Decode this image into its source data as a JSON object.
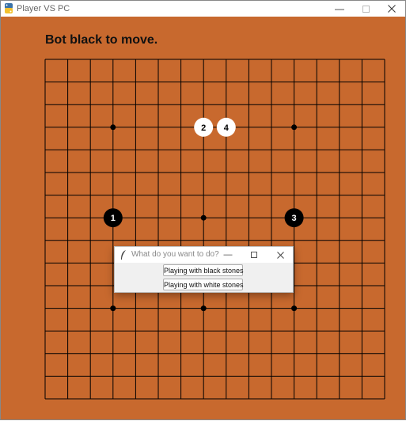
{
  "window": {
    "title": "Player VS PC",
    "icon": "python-icon"
  },
  "status_text": "Bot black to move.",
  "colors": {
    "board": "#c8692e",
    "line": "#000000",
    "black_stone": "#000000",
    "white_stone": "#ffffff"
  },
  "board": {
    "size": 15,
    "star_points": [
      [
        3,
        3
      ],
      [
        3,
        11
      ],
      [
        7,
        3
      ],
      [
        7,
        7
      ],
      [
        7,
        11
      ],
      [
        11,
        3
      ],
      [
        11,
        7
      ],
      [
        11,
        11
      ]
    ],
    "stones": [
      {
        "number": "1",
        "color": "black",
        "row": 7,
        "col": 3
      },
      {
        "number": "2",
        "color": "white",
        "row": 3,
        "col": 7
      },
      {
        "number": "3",
        "color": "black",
        "row": 7,
        "col": 11
      },
      {
        "number": "4",
        "color": "white",
        "row": 3,
        "col": 8
      }
    ]
  },
  "dialog": {
    "title": "What do you want to do?",
    "icon": "feather-icon",
    "buttons": {
      "black": "Playing with black stones",
      "white": "Playing with white stones"
    }
  }
}
